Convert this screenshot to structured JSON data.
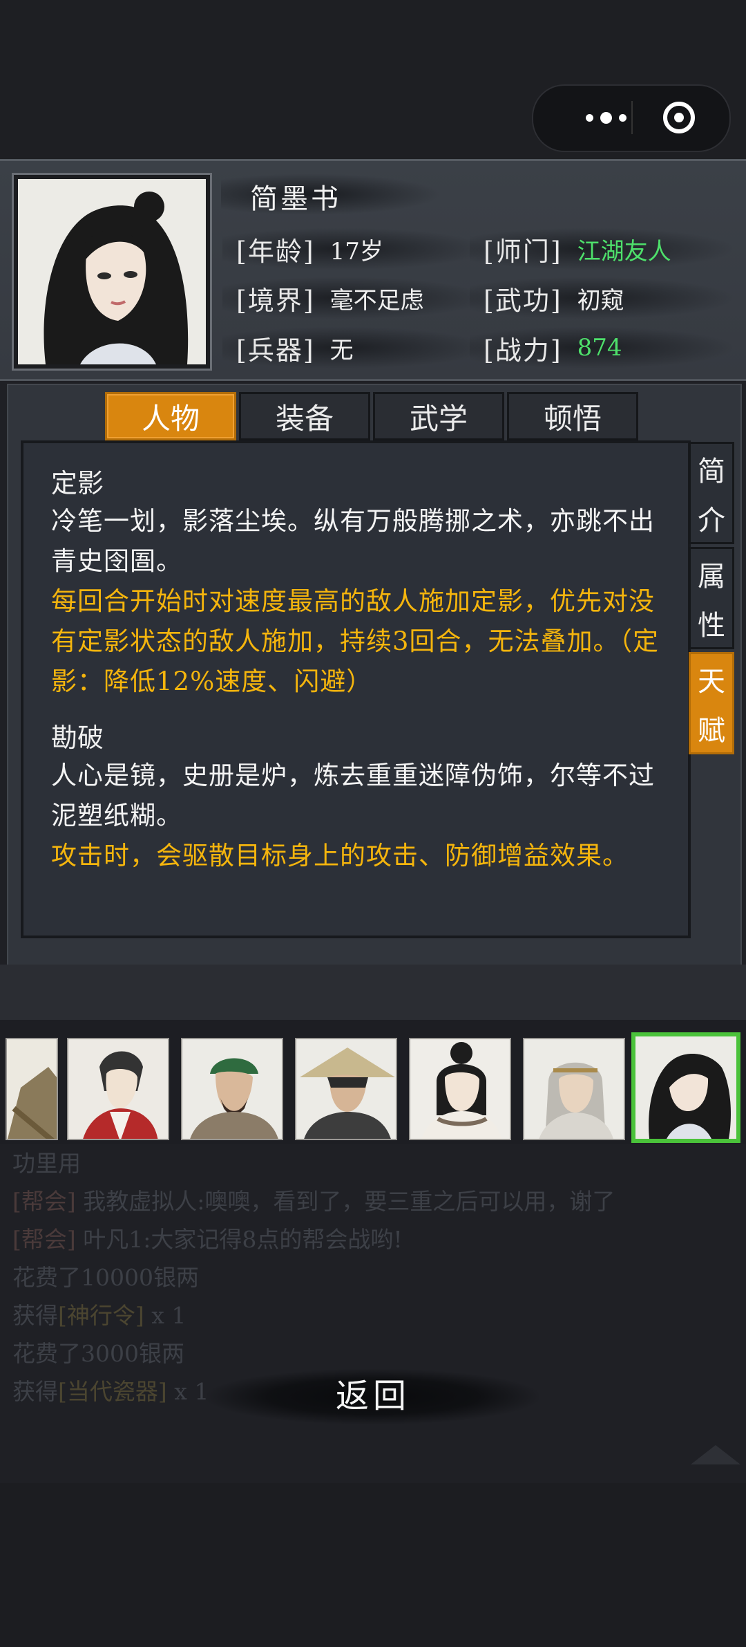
{
  "character": {
    "name": "简墨书",
    "stats": [
      {
        "label": "[年龄]",
        "value": "17岁",
        "color": "#efefef"
      },
      {
        "label": "[师门]",
        "value": "江湖友人",
        "color": "#4ee06b"
      },
      {
        "label": "[境界]",
        "value": "毫不足虑",
        "color": "#efefef"
      },
      {
        "label": "[武功]",
        "value": "初窥",
        "color": "#efefef"
      },
      {
        "label": "[兵器]",
        "value": "无",
        "color": "#efefef"
      },
      {
        "label": "[战力]",
        "value": "874",
        "color": "#4ee06b"
      }
    ]
  },
  "tabs": [
    "人物",
    "装备",
    "武学",
    "顿悟"
  ],
  "active_tab": "人物",
  "side_tabs": [
    {
      "chars": [
        "简",
        "介"
      ]
    },
    {
      "chars": [
        "属",
        "性"
      ]
    },
    {
      "chars": [
        "天",
        "赋"
      ]
    }
  ],
  "active_side_tab": "天赋",
  "talents": [
    {
      "name": "定影",
      "desc": "冷笔一划，影落尘埃。纵有万般腾挪之术，亦跳不出青史囹圄。",
      "effect": "每回合开始时对速度最高的敌人施加定影，优先对没有定影状态的敌人施加，持续3回合，无法叠加。（定影：降低12%速度、闪避）"
    },
    {
      "name": "勘破",
      "desc": "人心是镜，史册是炉，炼去重重迷障伪饰，尔等不过泥塑纸糊。",
      "effect": "攻击时，会驱散目标身上的攻击、防御增益效果。"
    }
  ],
  "log": {
    "line1": "功里用",
    "line2_tag": "[帮会]",
    "line2_text": " 我教虚拟人:噢噢，看到了，要三重之后可以用，谢了",
    "line3_tag": "[帮会]",
    "line3_text": " 叶凡1:大家记得8点的帮会战哟!",
    "line4": "花费了10000银两",
    "line5_pre": "获得",
    "line5_item": "[神行令]",
    "line5_suf": " x 1",
    "line6": "花费了3000银两",
    "line7_pre": "获得",
    "line7_item": "[当代瓷器]",
    "line7_suf": " x 1"
  },
  "back_label": "返回",
  "colors": {
    "accent_orange": "#d9860f",
    "effect_gold": "#f5b50d",
    "stat_green": "#4ee06b",
    "selected_border": "#4ac23a"
  }
}
